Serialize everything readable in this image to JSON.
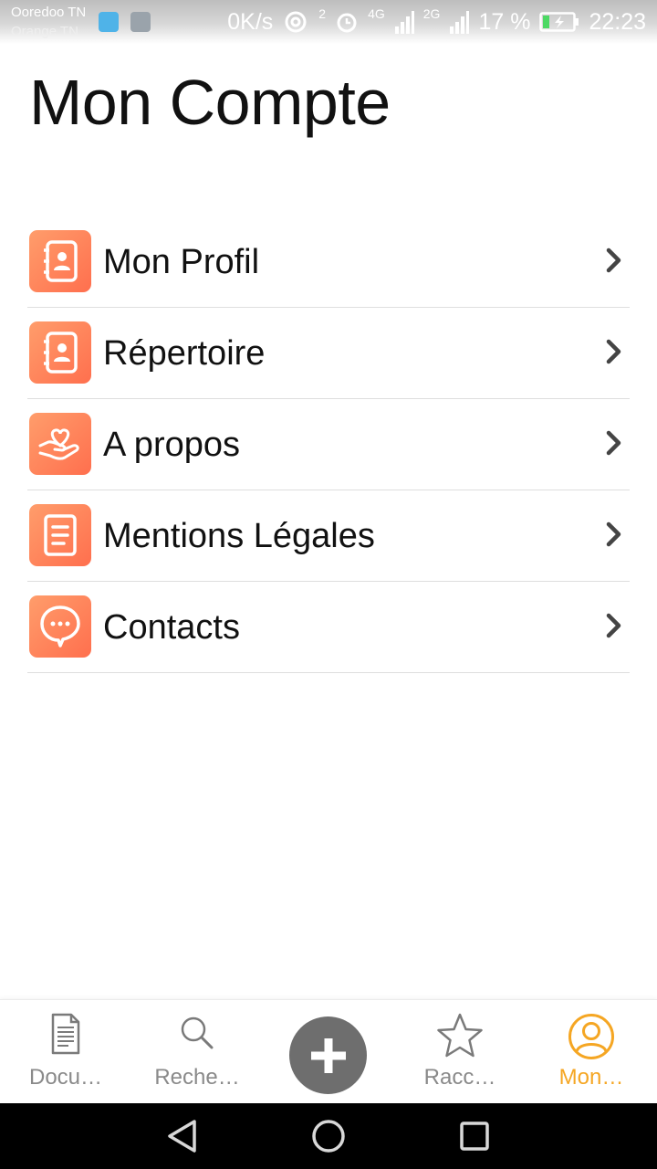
{
  "status_bar": {
    "carrier_primary": "Ooredoo TN",
    "carrier_secondary": "Orange TN",
    "speed": "0K/s",
    "sim_indicator": "2",
    "network_1": "4G",
    "network_2": "2G",
    "battery_percent": "17 %",
    "time": "22:23",
    "icons": [
      "usb-notification-icon",
      "image-notification-icon",
      "hotspot-icon",
      "alarm-icon",
      "signal-icon",
      "battery-charging-icon"
    ]
  },
  "header": {
    "title": "Mon Compte"
  },
  "menu": {
    "items": [
      {
        "label": "Mon Profil",
        "icon": "contact-book-icon"
      },
      {
        "label": "Répertoire",
        "icon": "contact-book-icon"
      },
      {
        "label": "A propos",
        "icon": "hand-heart-icon"
      },
      {
        "label": "Mentions Légales",
        "icon": "document-list-icon"
      },
      {
        "label": "Contacts",
        "icon": "chat-bubble-icon"
      }
    ],
    "chevron_icon": "chevron-right-icon"
  },
  "bottom_nav": {
    "tabs": [
      {
        "label": "Docu…",
        "icon": "document-icon",
        "active": false
      },
      {
        "label": "Reche…",
        "icon": "search-icon",
        "active": false
      },
      {
        "label": "Racc…",
        "icon": "star-icon",
        "active": false
      },
      {
        "label": "Mon…",
        "icon": "user-circle-icon",
        "active": true
      }
    ],
    "add_button_icon": "plus-icon",
    "active_color": "#f5a623",
    "inactive_color": "#8a8a8a"
  },
  "theme": {
    "icon_gradient_start": "#ff9d6b",
    "icon_gradient_end": "#ff6f4e",
    "accent": "#f5a623"
  },
  "system_nav": {
    "icons": [
      "back-icon",
      "home-icon",
      "recents-icon"
    ]
  }
}
